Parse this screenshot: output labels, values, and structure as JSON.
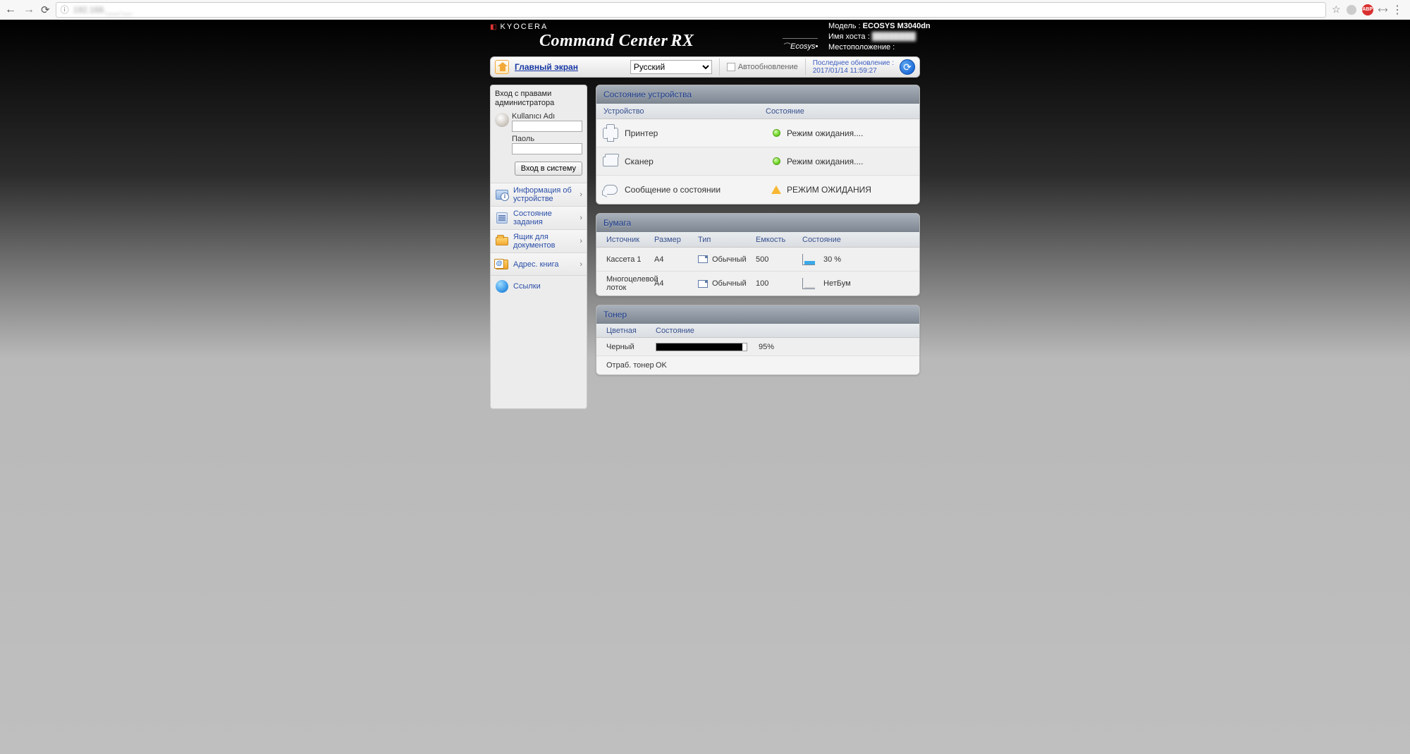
{
  "browser": {
    "url_masked": "192.168.___.__"
  },
  "header": {
    "brand": "KYOCERA",
    "product": "Command Center",
    "product_suffix": "RX",
    "ecosys": "Ecosys",
    "model_label": "Модель :",
    "model_value": "ECOSYS M3040dn",
    "hostname_label": "Имя хоста :",
    "hostname_value": "████████",
    "location_label": "Местоположение :",
    "location_value": ""
  },
  "toolbar": {
    "home": "Главный экран",
    "language": "Русский",
    "autorefresh": "Автообновление",
    "lastupdate_label": "Последнее обновление :",
    "lastupdate_value": "2017/01/14 11:59:27"
  },
  "sidebar": {
    "login_title": "Вход с правами администратора",
    "username_label": "Kullanıcı Adı",
    "password_label": "Паоль",
    "login_button": "Вход в систему",
    "items": [
      {
        "label": "Информация об устройстве"
      },
      {
        "label": "Состояние задания"
      },
      {
        "label": "Ящик для документов"
      },
      {
        "label": "Адрес. книга"
      }
    ],
    "links_label": "Ссылки"
  },
  "device_status": {
    "panel_title": "Состояние устройства",
    "col_device": "Устройство",
    "col_status": "Состояние",
    "rows": [
      {
        "name": "Принтер",
        "led": "green",
        "status": "Режим ожидания...."
      },
      {
        "name": "Сканер",
        "led": "green",
        "status": "Режим ожидания...."
      },
      {
        "name": "Сообщение о состоянии",
        "led": "warn",
        "status": "РЕЖИМ ОЖИДАНИЯ"
      }
    ]
  },
  "paper": {
    "panel_title": "Бумага",
    "cols": {
      "source": "Источник",
      "size": "Размер",
      "type": "Тип",
      "capacity": "Емкость",
      "status": "Состояние"
    },
    "rows": [
      {
        "source": "Кассета 1",
        "size": "A4",
        "type": "Обычный",
        "capacity": "500",
        "status": "30 %",
        "fill": 30
      },
      {
        "source": "Многоцелевой лоток",
        "size": "A4",
        "type": "Обычный",
        "capacity": "100",
        "status": "НетБум",
        "fill": 0
      }
    ]
  },
  "toner": {
    "panel_title": "Тонер",
    "col_color": "Цветная",
    "col_status": "Состояние",
    "black_label": "Черный",
    "black_pct": "95%",
    "black_fill": 95,
    "waste_label": "Отраб. тонер",
    "waste_value": "OK"
  }
}
